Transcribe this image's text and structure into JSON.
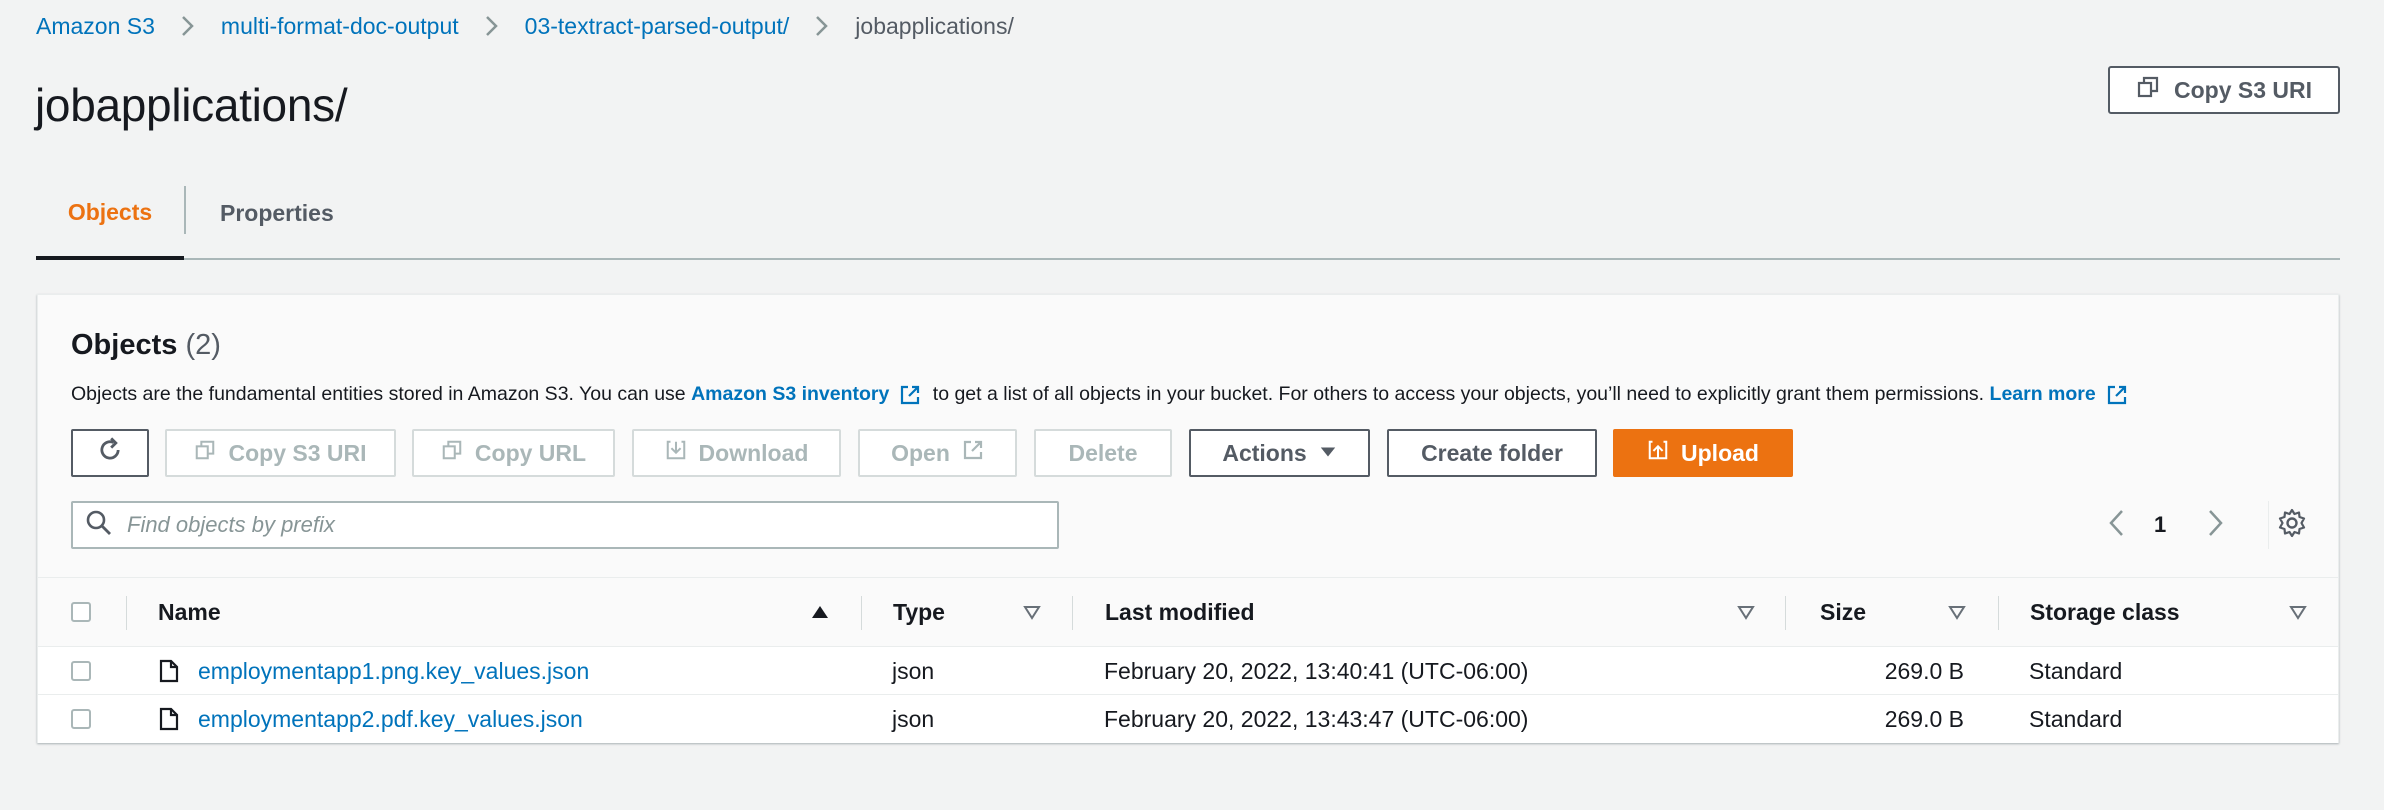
{
  "breadcrumb": {
    "items": [
      "Amazon S3",
      "multi-format-doc-output",
      "03-textract-parsed-output/"
    ],
    "current": "jobapplications/"
  },
  "page": {
    "title": "jobapplications/",
    "copy_uri_label": "Copy S3 URI"
  },
  "tabs": [
    {
      "label": "Objects",
      "active": true
    },
    {
      "label": "Properties",
      "active": false
    }
  ],
  "objects": {
    "heading": "Objects",
    "count": "(2)",
    "desc_before": "Objects are the fundamental entities stored in Amazon S3. You can use ",
    "desc_link": "Amazon S3 inventory",
    "desc_middle": " to get a list of all objects in your bucket. For others to access your objects, you’ll need to explicitly grant them permissions. ",
    "learn_more": "Learn more"
  },
  "toolbar": {
    "copy_s3_uri": "Copy S3 URI",
    "copy_url": "Copy URL",
    "download": "Download",
    "open": "Open",
    "delete": "Delete",
    "actions": "Actions",
    "create_folder": "Create folder",
    "upload": "Upload"
  },
  "search": {
    "placeholder": "Find objects by prefix",
    "value": ""
  },
  "pagination": {
    "current_page": "1"
  },
  "table": {
    "columns": [
      "Name",
      "Type",
      "Last modified",
      "Size",
      "Storage class"
    ],
    "rows": [
      {
        "name": "employmentapp1.png.key_values.json",
        "type": "json",
        "modified": "February 20, 2022, 13:40:41 (UTC-06:00)",
        "size": "269.0 B",
        "storage": "Standard"
      },
      {
        "name": "employmentapp2.pdf.key_values.json",
        "type": "json",
        "modified": "February 20, 2022, 13:43:47 (UTC-06:00)",
        "size": "269.0 B",
        "storage": "Standard"
      }
    ]
  },
  "colors": {
    "link": "#0073bb",
    "accent": "#ec7211",
    "text": "#16191f",
    "muted": "#545b64",
    "disabled": "#aab7b8",
    "background": "#f2f3f3"
  }
}
